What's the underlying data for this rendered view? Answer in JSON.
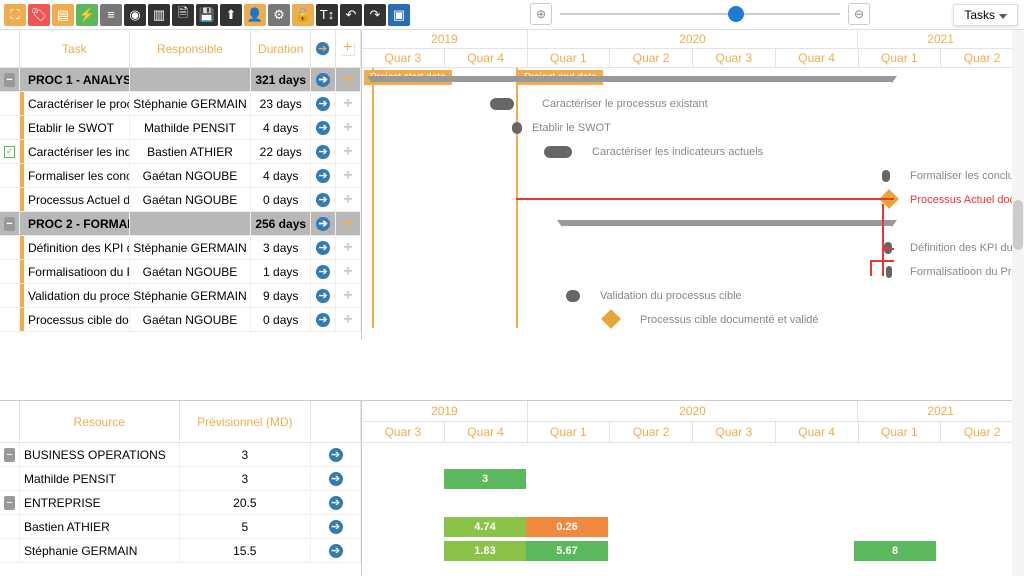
{
  "tasks_dropdown": "Tasks",
  "headers": {
    "task": "Task",
    "responsible": "Responsible",
    "duration": "Duration"
  },
  "years_top": [
    "2019",
    "2020",
    "2021"
  ],
  "quarters_top": [
    "Quar 3",
    "Quar 4",
    "Quar 1",
    "Quar 2",
    "Quar 3",
    "Quar 4",
    "Quar 1",
    "Quar 2"
  ],
  "flags": {
    "start": "Project start date",
    "end": "Project end date"
  },
  "tasks": [
    {
      "group": true,
      "name": "PROC 1 - ANALYS",
      "dur": "321 days"
    },
    {
      "name": "Caractériser le proc",
      "resp": "Stéphanie GERMAIN",
      "dur": "23 days"
    },
    {
      "name": "Etablir le SWOT",
      "resp": "Mathilde PENSIT",
      "dur": "4 days"
    },
    {
      "name": "Caractériser les ind",
      "resp": "Bastien ATHIER",
      "dur": "22 days",
      "checked": true
    },
    {
      "name": "Formaliser les conc",
      "resp": "Gaétan NGOUBE",
      "dur": "4 days"
    },
    {
      "name": "Processus Actuel d",
      "resp": "Gaétan NGOUBE",
      "dur": "0 days"
    },
    {
      "group": true,
      "name": "PROC 2 - FORMAL",
      "dur": "256 days"
    },
    {
      "name": "Définition des KPI d",
      "resp": "Stéphanie GERMAIN",
      "dur": "3 days"
    },
    {
      "name": "Formalisatioon du P",
      "resp": "Gaétan NGOUBE",
      "dur": "1 days"
    },
    {
      "name": "Validation du proce",
      "resp": "Stéphanie GERMAIN",
      "dur": "9 days"
    },
    {
      "name": "Processus cible doc",
      "resp": "Gaétan NGOUBE",
      "dur": "0 days"
    }
  ],
  "gantt_labels": [
    "Caractériser le processus existant",
    "Etablir le SWOT",
    "Caractériser les indicateurs actuels",
    "Formaliser les conclusi",
    "Processus Actuel doc",
    "Définition des KPI du p",
    "Formalisatioon du Pro",
    "Validation du processus cible",
    "Processus cible documenté et validé"
  ],
  "low_head": {
    "resource": "Resource",
    "prev": "Prévisionnel (MD)"
  },
  "loadrows": [
    {
      "group": true,
      "name": "BUSINESS OPERATIONS",
      "prev": "3"
    },
    {
      "name": "Mathilde PENSIT",
      "prev": "3"
    },
    {
      "group": true,
      "name": "ENTREPRISE",
      "prev": "20.5"
    },
    {
      "name": "Bastien ATHIER",
      "prev": "5"
    },
    {
      "name": "Stéphanie GERMAIN",
      "prev": "15.5"
    }
  ],
  "years_low": [
    "2019",
    "2020",
    "2021"
  ],
  "quarters_low": [
    "Quar 3",
    "Quar 4",
    "Quar 1",
    "Quar 2",
    "Quar 3",
    "Quar 4",
    "Quar 1",
    "Quar 2"
  ],
  "bars": {
    "p3": "3",
    "p474": "4.74",
    "p026": "0.26",
    "p183": "1.83",
    "p567": "5.67",
    "p8": "8"
  }
}
